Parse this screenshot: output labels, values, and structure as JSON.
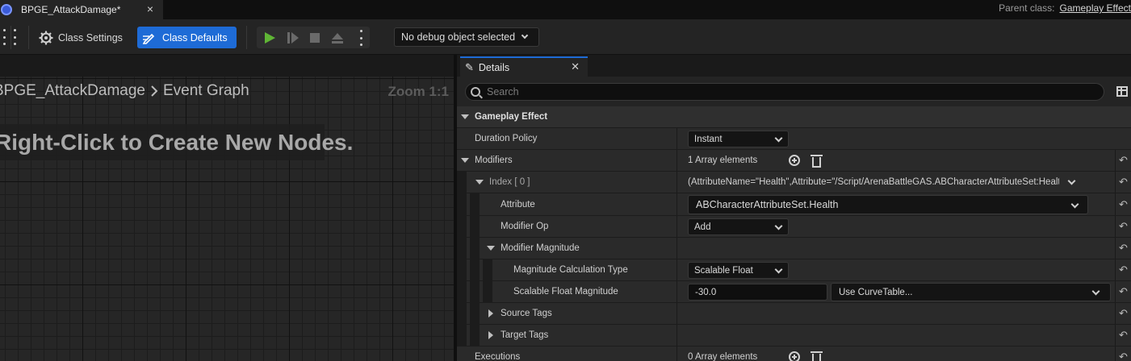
{
  "tab": {
    "title": "BPGE_AttackDamage*",
    "close": "×"
  },
  "parent_class": {
    "label": "Parent class:",
    "value": "Gameplay Effect"
  },
  "toolbar": {
    "class_settings": "Class Settings",
    "class_defaults": "Class Defaults",
    "debug_select": "No debug object selected"
  },
  "graph": {
    "breadcrumb": [
      "BPGE_AttackDamage",
      "Event Graph"
    ],
    "zoom": "Zoom 1:1",
    "hint": "Right-Click to Create New Nodes."
  },
  "details": {
    "tab_title": "Details",
    "search_placeholder": "Search",
    "category": "Gameplay Effect",
    "rows": {
      "duration_policy": {
        "label": "Duration Policy",
        "value": "Instant"
      },
      "modifiers": {
        "label": "Modifiers",
        "value": "1 Array elements"
      },
      "index0": {
        "label": "Index [ 0 ]",
        "value": "(AttributeName=\"Health\",Attribute=\"/Script/ArenaBattleGAS.ABCharacterAttributeSet:Health\""
      },
      "attribute": {
        "label": "Attribute",
        "value": "ABCharacterAttributeSet.Health"
      },
      "modifier_op": {
        "label": "Modifier Op",
        "value": "Add"
      },
      "modifier_magnitude": {
        "label": "Modifier Magnitude"
      },
      "magnitude_calc_type": {
        "label": "Magnitude Calculation Type",
        "value": "Scalable Float"
      },
      "scalable_float_magnitude": {
        "label": "Scalable Float Magnitude",
        "value": "-30.0",
        "curve": "Use CurveTable..."
      },
      "source_tags": {
        "label": "Source Tags"
      },
      "target_tags": {
        "label": "Target Tags"
      },
      "executions": {
        "label": "Executions",
        "value": "0 Array elements"
      }
    }
  },
  "colors": {
    "accent": "#1e6bd6",
    "play": "#5fb535"
  }
}
